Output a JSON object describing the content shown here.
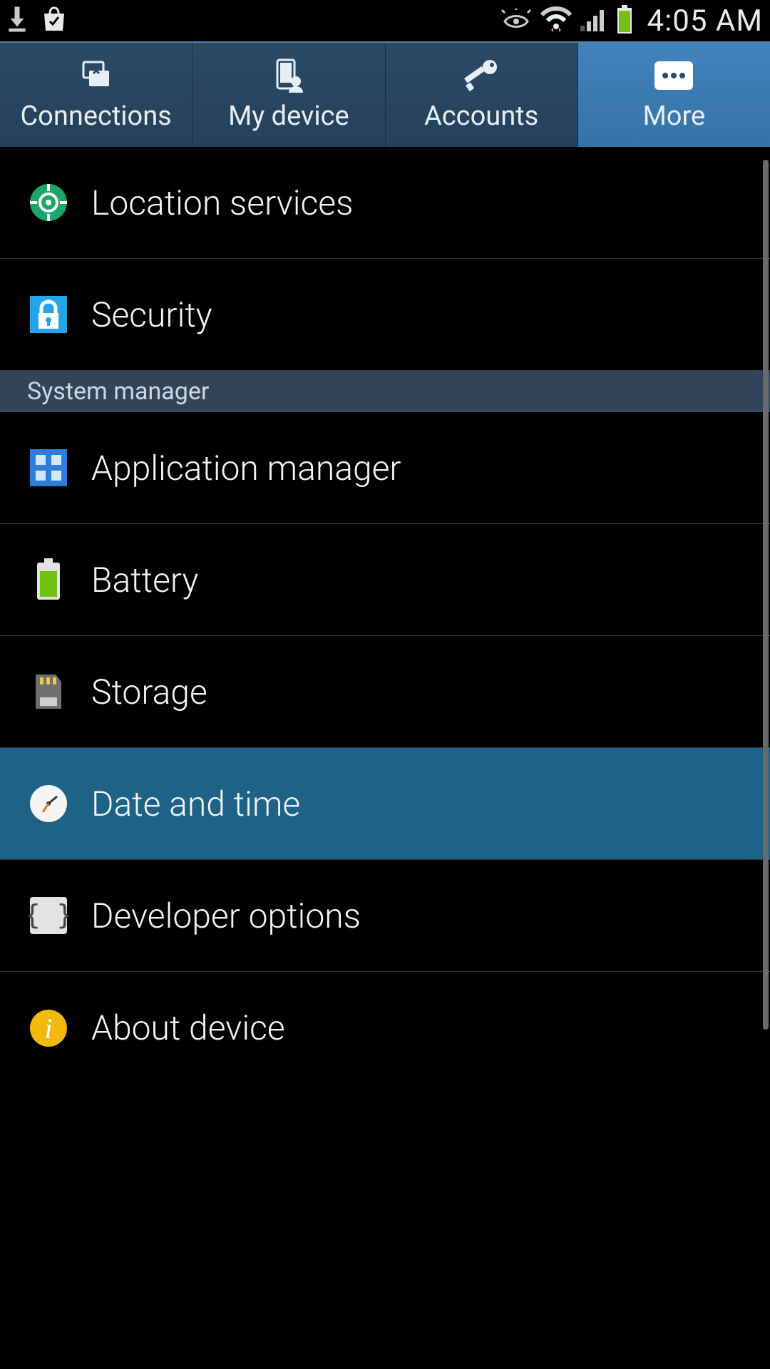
{
  "status": {
    "time": "4:05 AM"
  },
  "tabs": [
    {
      "label": "Connections"
    },
    {
      "label": "My device"
    },
    {
      "label": "Accounts"
    },
    {
      "label": "More"
    }
  ],
  "section": {
    "system_manager": "System manager"
  },
  "items": {
    "location": "Location services",
    "security": "Security",
    "app_manager": "Application manager",
    "battery": "Battery",
    "storage": "Storage",
    "date_time": "Date and time",
    "developer": "Developer options",
    "about": "About device"
  }
}
